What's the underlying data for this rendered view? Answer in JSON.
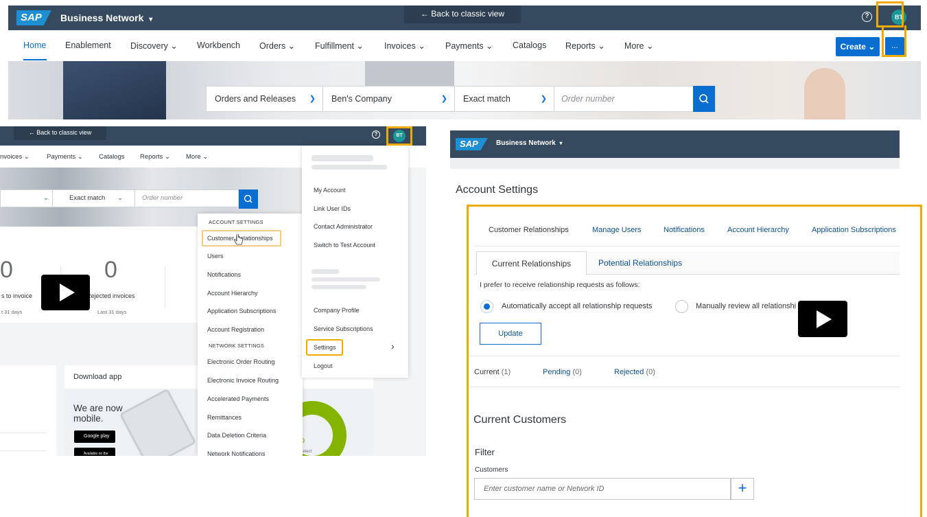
{
  "top": {
    "logo": "SAP",
    "brand": "Business Network",
    "brand_caret": "▾",
    "classic_view": "←  Back to classic view",
    "help": "?",
    "avatar": "BT",
    "nav": [
      "Home",
      "Enablement",
      "Discovery ⌄",
      "Workbench",
      "Orders ⌄",
      "Fulfillment ⌄",
      "Invoices ⌄",
      "Payments ⌄",
      "Catalogs",
      "Reports ⌄",
      "More ⌄"
    ],
    "create_label": "Create ⌄",
    "more_label": "...",
    "search": {
      "type_value": "Orders and Releases",
      "company_value": "Ben's Company",
      "match_value": "Exact match",
      "placeholder": "Order number"
    },
    "colors": {
      "shell": "#354a5f",
      "accent": "#0a6ed1",
      "highlight": "#f0ab00"
    }
  },
  "left": {
    "classic_view": "←  Back to classic view",
    "help": "?",
    "avatar": "BT",
    "nav": [
      "nvoices ⌄",
      "Payments ⌄",
      "Catalogs",
      "Reports ⌄",
      "More ⌄"
    ],
    "search": {
      "match_value": "Exact match",
      "placeholder": "Order number"
    },
    "tile1": {
      "value": "0",
      "label": "s to invoice",
      "sub": "t 31 days"
    },
    "tile2": {
      "value": "0",
      "label": "Rejected invoices",
      "sub": "Last 31 days"
    },
    "download_title": "Download app",
    "mobile_text": "We are now\nmobile.",
    "google_play": "Google play",
    "app_store": "Available on the",
    "donut_pct": "%",
    "donut_sub": "letect",
    "account_settings_header": "ACCOUNT SETTINGS",
    "account_items": [
      "Customer Relationships",
      "Users",
      "Notifications",
      "Account Hierarchy",
      "Application Subscriptions",
      "Account Registration"
    ],
    "network_settings_header": "NETWORK SETTINGS",
    "network_items": [
      "Electronic Order Routing",
      "Electronic Invoice Routing",
      "Accelerated Payments",
      "Remittances",
      "Data Deletion Criteria",
      "Network Notifications"
    ],
    "user_menu": [
      "My Account",
      "Link User IDs",
      "Contact Administrator",
      "Switch to Test Account"
    ],
    "company_menu": [
      "Company Profile",
      "Service Subscriptions",
      "Settings",
      "Logout"
    ],
    "submenu_arrow": "›"
  },
  "right": {
    "logo": "SAP",
    "brand": "Business Network",
    "brand_caret": "▾",
    "title": "Account Settings",
    "tabs": [
      "Customer Relationships",
      "Manage Users",
      "Notifications",
      "Account Hierarchy",
      "Application Subscriptions"
    ],
    "subtabs": [
      "Current Relationships",
      "Potential Relationships"
    ],
    "preference_text": "I prefer to receive relationship requests as follows:",
    "radio_auto": "Automatically accept all relationship requests",
    "radio_manual": "Manually review all relationshi",
    "update_label": "Update",
    "status_tabs": [
      {
        "label": "Current",
        "count": "(1)"
      },
      {
        "label": "Pending",
        "count": "(0)"
      },
      {
        "label": "Rejected",
        "count": "(0)"
      }
    ],
    "current_customers": "Current Customers",
    "filter": "Filter",
    "customers_label": "Customers",
    "customer_placeholder": "Enter customer name or Network ID",
    "plus": "+"
  }
}
